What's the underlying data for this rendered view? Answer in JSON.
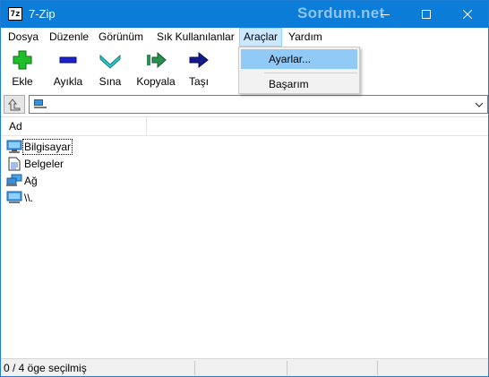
{
  "window": {
    "title": "7-Zip",
    "app_icon_text": "7z",
    "watermark": "Sordum.net",
    "titlebar_color": "#0b7cd7"
  },
  "menubar": {
    "items": [
      {
        "label": "Dosya"
      },
      {
        "label": "Düzenle"
      },
      {
        "label": "Görünüm"
      },
      {
        "label": "Sık Kullanılanlar"
      },
      {
        "label": "Araçlar"
      },
      {
        "label": "Yardım"
      }
    ]
  },
  "toolbar": {
    "buttons": [
      {
        "label": "Ekle",
        "icon": "plus-icon"
      },
      {
        "label": "Ayıkla",
        "icon": "minus-icon"
      },
      {
        "label": "Sına",
        "icon": "check-chevron-icon"
      },
      {
        "label": "Kopyala",
        "icon": "copy-arrow-icon"
      },
      {
        "label": "Taşı",
        "icon": "move-arrow-icon"
      }
    ]
  },
  "addressbar": {
    "value": "",
    "icon": "computer-small-icon"
  },
  "filelist": {
    "columns": [
      {
        "label": "Ad"
      }
    ],
    "items": [
      {
        "name": "Bilgisayar",
        "icon": "computer-icon"
      },
      {
        "name": "Belgeler",
        "icon": "documents-icon"
      },
      {
        "name": "Ağ",
        "icon": "network-icon"
      },
      {
        "name": "\\\\.",
        "icon": "monitor-icon"
      }
    ]
  },
  "statusbar": {
    "selection": "0 / 4 öge seçilmiş",
    "size": "",
    "total": "",
    "date": ""
  },
  "dropdown": {
    "items": [
      {
        "label": "Ayarlar...",
        "highlighted": true
      },
      {
        "label": "Başarım",
        "highlighted": false
      }
    ]
  }
}
